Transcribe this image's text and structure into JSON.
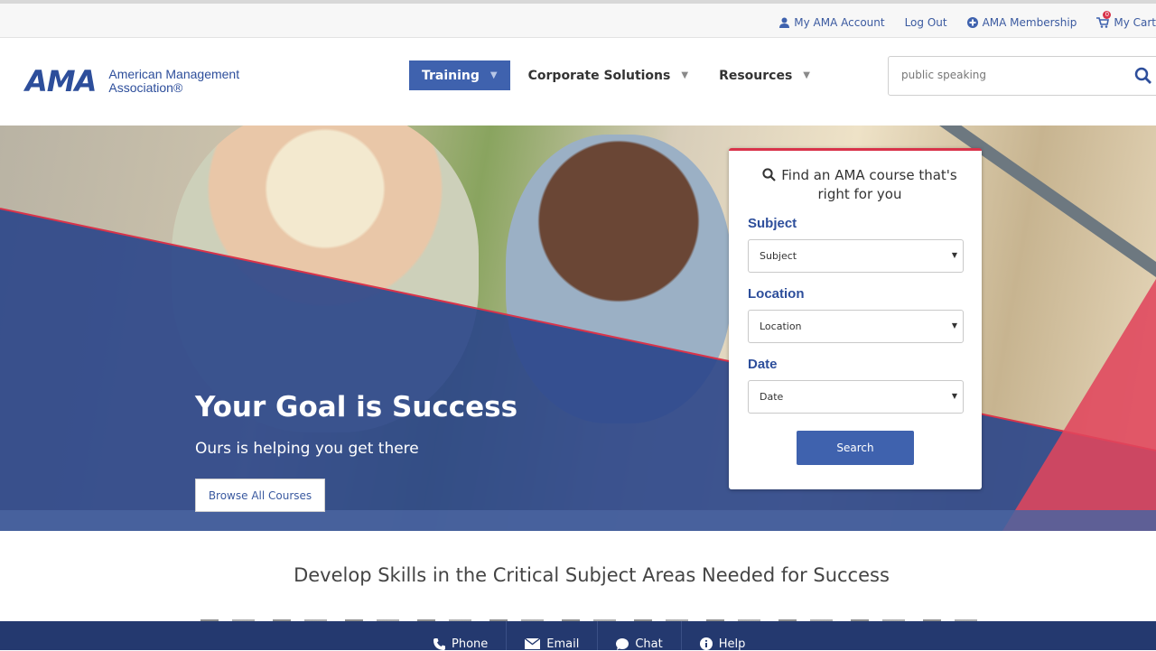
{
  "topbar": {
    "account": "My AMA Account",
    "logout": "Log Out",
    "membership": "AMA Membership",
    "cart": "My Cart",
    "cart_count": "0"
  },
  "brand": {
    "mark": "AMA",
    "line1": "American Management",
    "line2": "Association®"
  },
  "nav": {
    "training": "Training",
    "corporate": "Corporate Solutions",
    "resources": "Resources"
  },
  "search": {
    "value": "public speaking"
  },
  "hero": {
    "title": "Your Goal is Success",
    "subtitle": "Ours is helping you get there",
    "browse": "Browse All Courses"
  },
  "finder": {
    "title": "Find an AMA course that's right for you",
    "subject_label": "Subject",
    "subject_value": "Subject",
    "location_label": "Location",
    "location_value": "Location",
    "date_label": "Date",
    "date_value": "Date",
    "search_button": "Search"
  },
  "section": {
    "title": "Develop Skills in the Critical Subject Areas Needed for Success"
  },
  "bottombar": {
    "phone": "Phone",
    "email": "Email",
    "chat": "Chat",
    "help": "Help"
  },
  "colors": {
    "brand_blue": "#3f62ae",
    "accent_red": "#d9334a",
    "overlay_blue": "#2a4589",
    "footer_blue": "#24396f"
  }
}
